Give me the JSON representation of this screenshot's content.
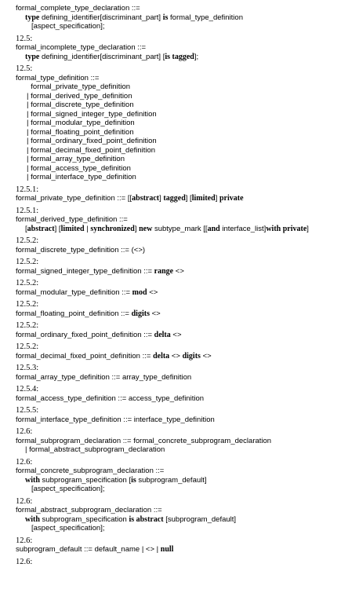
{
  "sections": [
    {
      "ref": "",
      "lines": [
        {
          "indent": 0,
          "parts": [
            {
              "t": "formal_complete_type_declaration ::="
            }
          ]
        },
        {
          "indent": 1,
          "parts": [
            {
              "t": "type",
              "kw": true
            },
            {
              "t": " defining_identifier[discriminant_part] "
            },
            {
              "t": "is",
              "kw": true
            },
            {
              "t": " formal_type_definition"
            }
          ]
        },
        {
          "indent": 2,
          "parts": [
            {
              "t": "[aspect_specification];"
            }
          ]
        }
      ]
    },
    {
      "ref": "12.5:",
      "lines": [
        {
          "indent": 0,
          "parts": [
            {
              "t": "formal_incomplete_type_declaration ::="
            }
          ]
        },
        {
          "indent": 1,
          "parts": [
            {
              "t": "type",
              "kw": true
            },
            {
              "t": " defining_identifier[discriminant_part] ["
            },
            {
              "t": "is tagged",
              "kw": true
            },
            {
              "t": "];"
            }
          ]
        }
      ]
    },
    {
      "ref": "12.5:",
      "lines": [
        {
          "indent": 0,
          "parts": [
            {
              "t": "formal_type_definition ::="
            }
          ]
        },
        {
          "indent": 3,
          "parts": [
            {
              "t": "  formal_private_type_definition"
            }
          ]
        },
        {
          "indent": 3,
          "parts": [
            {
              "t": "| formal_derived_type_definition"
            }
          ]
        },
        {
          "indent": 3,
          "parts": [
            {
              "t": "| formal_discrete_type_definition"
            }
          ]
        },
        {
          "indent": 3,
          "parts": [
            {
              "t": "| formal_signed_integer_type_definition"
            }
          ]
        },
        {
          "indent": 3,
          "parts": [
            {
              "t": "| formal_modular_type_definition"
            }
          ]
        },
        {
          "indent": 3,
          "parts": [
            {
              "t": "| formal_floating_point_definition"
            }
          ]
        },
        {
          "indent": 3,
          "parts": [
            {
              "t": "| formal_ordinary_fixed_point_definition"
            }
          ]
        },
        {
          "indent": 3,
          "parts": [
            {
              "t": "| formal_decimal_fixed_point_definition"
            }
          ]
        },
        {
          "indent": 3,
          "parts": [
            {
              "t": "| formal_array_type_definition"
            }
          ]
        },
        {
          "indent": 3,
          "parts": [
            {
              "t": "| formal_access_type_definition"
            }
          ]
        },
        {
          "indent": 3,
          "parts": [
            {
              "t": "| formal_interface_type_definition"
            }
          ]
        }
      ]
    },
    {
      "ref": "12.5.1:",
      "lines": [
        {
          "indent": 0,
          "parts": [
            {
              "t": "formal_private_type_definition ::= [["
            },
            {
              "t": "abstract",
              "kw": true
            },
            {
              "t": "] "
            },
            {
              "t": "tagged",
              "kw": true
            },
            {
              "t": "] ["
            },
            {
              "t": "limited",
              "kw": true
            },
            {
              "t": "] "
            },
            {
              "t": "private",
              "kw": true
            }
          ]
        }
      ]
    },
    {
      "ref": "12.5.1:",
      "lines": [
        {
          "indent": 0,
          "parts": [
            {
              "t": "formal_derived_type_definition ::="
            }
          ]
        },
        {
          "indent": 1,
          "parts": [
            {
              "t": "["
            },
            {
              "t": "abstract",
              "kw": true
            },
            {
              "t": "] ["
            },
            {
              "t": "limited",
              "kw": true
            },
            {
              "t": " | "
            },
            {
              "t": "synchronized",
              "kw": true
            },
            {
              "t": "] "
            },
            {
              "t": "new",
              "kw": true
            },
            {
              "t": " subtype_mark [["
            },
            {
              "t": "and",
              "kw": true
            },
            {
              "t": " interface_list]"
            },
            {
              "t": "with private",
              "kw": true
            },
            {
              "t": "]"
            }
          ]
        }
      ]
    },
    {
      "ref": "12.5.2:",
      "lines": [
        {
          "indent": 0,
          "parts": [
            {
              "t": "formal_discrete_type_definition ::= ("
            },
            {
              "t": "<>",
              "box": true
            },
            {
              "t": ")"
            }
          ]
        }
      ]
    },
    {
      "ref": "12.5.2:",
      "lines": [
        {
          "indent": 0,
          "parts": [
            {
              "t": "formal_signed_integer_type_definition ::= "
            },
            {
              "t": "range",
              "kw": true
            },
            {
              "t": " "
            },
            {
              "t": "<>",
              "box": true
            }
          ]
        }
      ]
    },
    {
      "ref": "12.5.2:",
      "lines": [
        {
          "indent": 0,
          "parts": [
            {
              "t": "formal_modular_type_definition ::= "
            },
            {
              "t": "mod",
              "kw": true
            },
            {
              "t": " "
            },
            {
              "t": "<>",
              "box": true
            }
          ]
        }
      ]
    },
    {
      "ref": "12.5.2:",
      "lines": [
        {
          "indent": 0,
          "parts": [
            {
              "t": "formal_floating_point_definition ::= "
            },
            {
              "t": "digits",
              "kw": true
            },
            {
              "t": " "
            },
            {
              "t": "<>",
              "box": true
            }
          ]
        }
      ]
    },
    {
      "ref": "12.5.2:",
      "lines": [
        {
          "indent": 0,
          "parts": [
            {
              "t": "formal_ordinary_fixed_point_definition ::= "
            },
            {
              "t": "delta",
              "kw": true
            },
            {
              "t": " "
            },
            {
              "t": "<>",
              "box": true
            }
          ]
        }
      ]
    },
    {
      "ref": "12.5.2:",
      "lines": [
        {
          "indent": 0,
          "parts": [
            {
              "t": "formal_decimal_fixed_point_definition ::= "
            },
            {
              "t": "delta",
              "kw": true
            },
            {
              "t": " "
            },
            {
              "t": "<>",
              "box": true
            },
            {
              "t": " "
            },
            {
              "t": "digits",
              "kw": true
            },
            {
              "t": " "
            },
            {
              "t": "<>",
              "box": true
            }
          ]
        }
      ]
    },
    {
      "ref": "12.5.3:",
      "lines": [
        {
          "indent": 0,
          "parts": [
            {
              "t": "formal_array_type_definition ::= array_type_definition"
            }
          ]
        }
      ]
    },
    {
      "ref": "12.5.4:",
      "lines": [
        {
          "indent": 0,
          "parts": [
            {
              "t": "formal_access_type_definition ::= access_type_definition"
            }
          ]
        }
      ]
    },
    {
      "ref": "12.5.5:",
      "lines": [
        {
          "indent": 0,
          "parts": [
            {
              "t": "formal_interface_type_definition ::= interface_type_definition"
            }
          ]
        }
      ]
    },
    {
      "ref": "12.6:",
      "lines": [
        {
          "indent": 0,
          "parts": [
            {
              "t": "formal_subprogram_declaration ::= formal_concrete_subprogram_declaration"
            }
          ]
        },
        {
          "indent": 1,
          "parts": [
            {
              "t": "| formal_abstract_subprogram_declaration"
            }
          ]
        }
      ]
    },
    {
      "ref": "12.6:",
      "lines": [
        {
          "indent": 0,
          "parts": [
            {
              "t": "formal_concrete_subprogram_declaration ::="
            }
          ]
        },
        {
          "indent": 1,
          "parts": [
            {
              "t": "with",
              "kw": true
            },
            {
              "t": " subprogram_specification ["
            },
            {
              "t": "is",
              "kw": true
            },
            {
              "t": " subprogram_default]"
            }
          ]
        },
        {
          "indent": 2,
          "parts": [
            {
              "t": "[aspect_specification];"
            }
          ]
        }
      ]
    },
    {
      "ref": "12.6:",
      "lines": [
        {
          "indent": 0,
          "parts": [
            {
              "t": "formal_abstract_subprogram_declaration ::="
            }
          ]
        },
        {
          "indent": 1,
          "parts": [
            {
              "t": "with",
              "kw": true
            },
            {
              "t": " subprogram_specification "
            },
            {
              "t": "is abstract",
              "kw": true
            },
            {
              "t": " [subprogram_default]"
            }
          ]
        },
        {
          "indent": 2,
          "parts": [
            {
              "t": "[aspect_specification];"
            }
          ]
        }
      ]
    },
    {
      "ref": "12.6:",
      "lines": [
        {
          "indent": 0,
          "parts": [
            {
              "t": "subprogram_default ::= default_name | "
            },
            {
              "t": "<>",
              "box": true
            },
            {
              "t": " | "
            },
            {
              "t": "null",
              "kw": true
            }
          ]
        }
      ]
    },
    {
      "ref": "12.6:",
      "lines": []
    }
  ]
}
